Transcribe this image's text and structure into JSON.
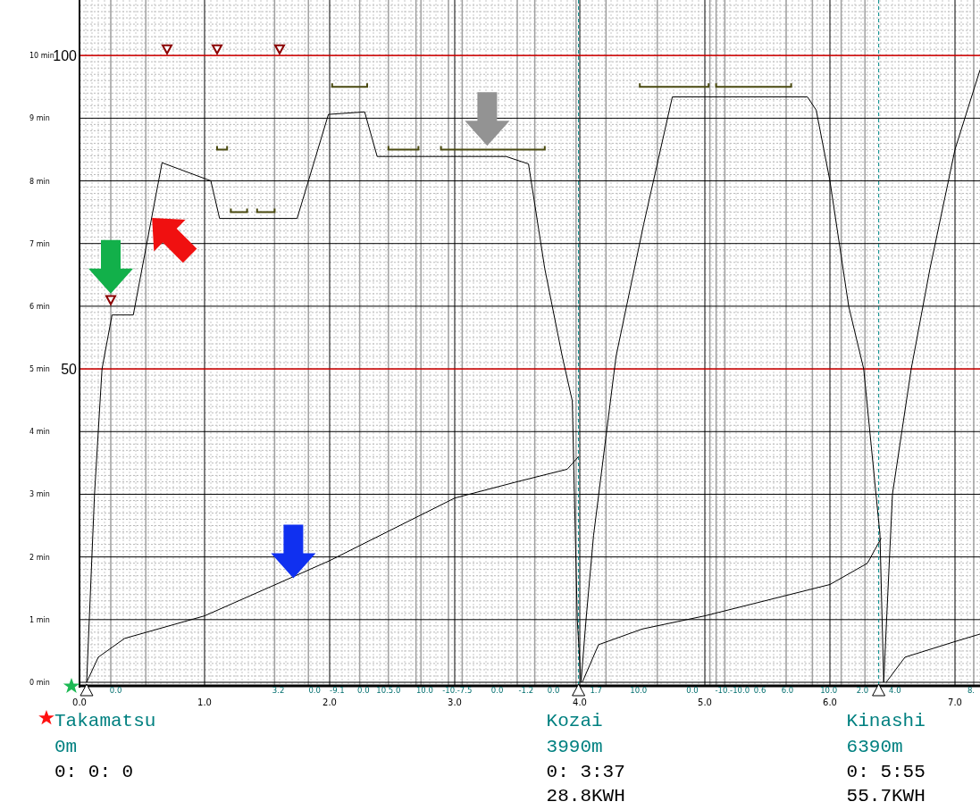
{
  "chart": {
    "chart_data": {
      "type": "line",
      "xlim": [
        0,
        7.2
      ],
      "ylim": [
        0,
        10.9
      ],
      "grid": true,
      "xticks": [
        {
          "value": 0,
          "label": "0.0"
        },
        {
          "value": 1,
          "label": "1.0"
        },
        {
          "value": 2,
          "label": "2.0"
        },
        {
          "value": 3,
          "label": "3.0"
        },
        {
          "value": 4,
          "label": "4.0"
        },
        {
          "value": 5,
          "label": "5.0"
        },
        {
          "value": 6,
          "label": "6.0"
        },
        {
          "value": 7,
          "label": "7.0"
        }
      ],
      "yticks": [
        {
          "value": 0,
          "label": "0 min"
        },
        {
          "value": 1,
          "label": "1 min"
        },
        {
          "value": 2,
          "label": "2 min"
        },
        {
          "value": 3,
          "label": "3 min"
        },
        {
          "value": 4,
          "label": "4 min"
        },
        {
          "value": 5,
          "label": "5 min"
        },
        {
          "value": 6,
          "label": "6 min"
        },
        {
          "value": 7,
          "label": "7 min"
        },
        {
          "value": 8,
          "label": "8 min"
        },
        {
          "value": 9,
          "label": "9 min"
        },
        {
          "value": 10,
          "label": "10 min"
        }
      ],
      "annotations": [
        "100",
        "50"
      ],
      "ref_lines": [
        {
          "axis": "x",
          "value": 3.99
        },
        {
          "axis": "x",
          "value": 6.39
        }
      ],
      "series": [
        {
          "color": "#000000",
          "x": [
            0.057,
            0.12,
            0.18,
            0.26,
            0.43,
            0.66,
            1.05,
            1.12,
            1.74,
            1.99,
            2.28,
            2.38,
            3.41,
            3.59,
            3.72,
            3.86,
            3.94,
            3.98,
            4.01,
            4.05,
            4.11,
            4.29,
            4.51,
            4.74,
            5.82,
            5.89,
            6.0,
            6.15,
            6.27,
            6.4,
            6.43,
            6.5,
            6.65,
            6.8,
            7.0,
            7.2
          ],
          "values": [
            0,
            3,
            5,
            5.86,
            5.86,
            8.29,
            8,
            7.4,
            7.4,
            9.06,
            9.1,
            8.39,
            8.39,
            8.27,
            6.6,
            5.2,
            4.49,
            1,
            0,
            1,
            2.34,
            5.2,
            7.3,
            9.34,
            9.34,
            9.13,
            8,
            6,
            5,
            2.36,
            0,
            3,
            5,
            6.6,
            8.5,
            9.77
          ]
        },
        {
          "color": "#000000",
          "x": [
            0.057,
            0.15,
            0.36,
            1.0,
            2.0,
            3.0,
            3.5,
            3.9,
            3.99
          ],
          "values": [
            0,
            0.4,
            0.7,
            1.06,
            1.94,
            2.94,
            3.2,
            3.4,
            3.6
          ]
        },
        {
          "color": "#000000",
          "x": [
            4.02,
            4.15,
            4.5,
            5.0,
            6.0,
            6.3,
            6.41
          ],
          "values": [
            0,
            0.6,
            0.85,
            1.06,
            1.56,
            1.9,
            2.3
          ]
        },
        {
          "color": "#000000",
          "x": [
            6.45,
            6.6,
            7.0,
            7.2
          ],
          "values": [
            0,
            0.4,
            0.65,
            0.77
          ]
        }
      ]
    },
    "gradient_labels": [
      "0.0",
      "3.2",
      "0.0",
      "-9.1",
      "0.0",
      "10.5.0",
      "10.0",
      "-10.-7.5",
      "0.0",
      "-1.2",
      "0.0",
      "1.7",
      "10.0",
      "0.0",
      "-10.-10.0",
      "0.6",
      "6.0",
      "10.0",
      "2.0",
      "4.0",
      "8."
    ],
    "arrows": [
      {
        "kind": "down",
        "color": "#12b04a"
      },
      {
        "kind": "up-left",
        "color": "#f01010"
      },
      {
        "kind": "down",
        "color": "#939393"
      },
      {
        "kind": "down",
        "color": "#1030f0"
      }
    ]
  },
  "stations": [
    {
      "name": "Takamatsu",
      "origin": true,
      "distance": "0m",
      "time": "0: 0: 0"
    },
    {
      "name": "Kozai",
      "origin": false,
      "distance": "3990m",
      "time": "0: 3:37",
      "energy": "28.8KWH"
    },
    {
      "name": "Kinashi",
      "origin": false,
      "distance": "6390m",
      "time": "0: 5:55",
      "energy": "55.7KWH"
    }
  ]
}
